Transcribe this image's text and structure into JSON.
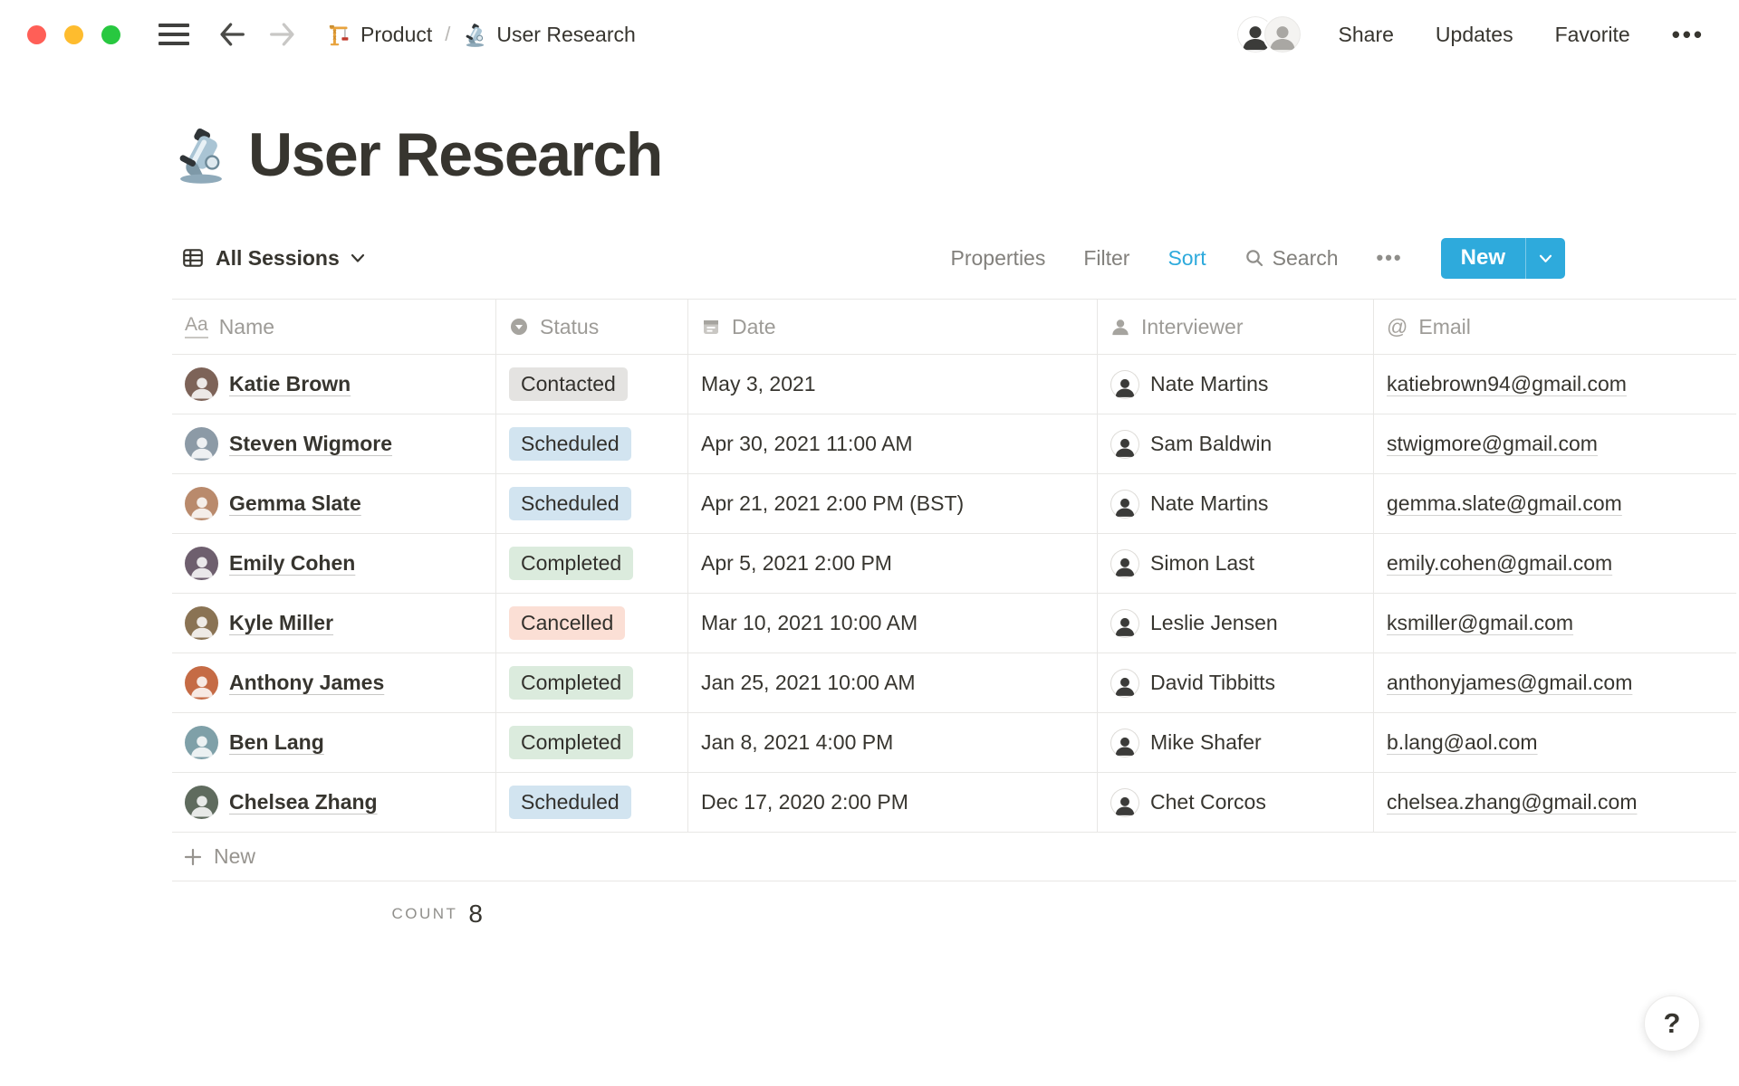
{
  "window": {
    "traffic_lights": {
      "close": "#FF5F57",
      "minimize": "#FEBC2E",
      "zoom": "#28C840"
    }
  },
  "topbar": {
    "breadcrumb": [
      {
        "icon": "crane-icon",
        "label": "Product"
      },
      {
        "icon": "microscope-icon",
        "label": "User Research"
      }
    ],
    "separator": "/",
    "share_label": "Share",
    "updates_label": "Updates",
    "favorite_label": "Favorite",
    "more_label": "•••"
  },
  "page": {
    "icon": "microscope-icon",
    "title": "User Research"
  },
  "view_toolbar": {
    "view_name": "All Sessions",
    "properties_label": "Properties",
    "filter_label": "Filter",
    "sort_label": "Sort",
    "sort_active_color": "#2EAADC",
    "search_label": "Search",
    "more_label": "•••",
    "new_button": {
      "label": "New",
      "color": "#2EAADC"
    }
  },
  "table": {
    "columns": [
      {
        "key": "name",
        "label": "Name",
        "icon": "text-icon"
      },
      {
        "key": "status",
        "label": "Status",
        "icon": "select-icon"
      },
      {
        "key": "date",
        "label": "Date",
        "icon": "calendar-icon"
      },
      {
        "key": "interviewer",
        "label": "Interviewer",
        "icon": "person-icon"
      },
      {
        "key": "email",
        "label": "Email",
        "icon": "at-icon"
      }
    ],
    "rows": [
      {
        "name": "Katie Brown",
        "status": "Contacted",
        "status_color": "gray",
        "date": "May 3, 2021",
        "interviewer": "Nate Martins",
        "email": "katiebrown94@gmail.com"
      },
      {
        "name": "Steven Wigmore",
        "status": "Scheduled",
        "status_color": "blue",
        "date": "Apr 30, 2021 11:00 AM",
        "interviewer": "Sam Baldwin",
        "email": "stwigmore@gmail.com"
      },
      {
        "name": "Gemma Slate",
        "status": "Scheduled",
        "status_color": "blue",
        "date": "Apr 21, 2021 2:00 PM (BST)",
        "interviewer": "Nate Martins",
        "email": "gemma.slate@gmail.com"
      },
      {
        "name": "Emily Cohen",
        "status": "Completed",
        "status_color": "green",
        "date": "Apr 5, 2021 2:00 PM",
        "interviewer": "Simon Last",
        "email": "emily.cohen@gmail.com"
      },
      {
        "name": "Kyle Miller",
        "status": "Cancelled",
        "status_color": "red",
        "date": "Mar 10, 2021 10:00 AM",
        "interviewer": "Leslie Jensen",
        "email": "ksmiller@gmail.com"
      },
      {
        "name": "Anthony James",
        "status": "Completed",
        "status_color": "green",
        "date": "Jan 25, 2021 10:00 AM",
        "interviewer": "David Tibbitts",
        "email": "anthonyjames@gmail.com"
      },
      {
        "name": "Ben Lang",
        "status": "Completed",
        "status_color": "green",
        "date": "Jan 8, 2021 4:00 PM",
        "interviewer": "Mike Shafer",
        "email": "b.lang@aol.com"
      },
      {
        "name": "Chelsea Zhang",
        "status": "Scheduled",
        "status_color": "blue",
        "date": "Dec 17, 2020 2:00 PM",
        "interviewer": "Chet Corcos",
        "email": "chelsea.zhang@gmail.com"
      }
    ],
    "new_row_label": "New",
    "footer": {
      "count_label": "COUNT",
      "count_value": "8"
    }
  },
  "status_colors": {
    "gray": {
      "bg": "#E4E3E1",
      "text": "#32302C"
    },
    "blue": {
      "bg": "#D2E4F0",
      "text": "#32302C"
    },
    "green": {
      "bg": "#DBEBDD",
      "text": "#32302C"
    },
    "red": {
      "bg": "#FBDFD5",
      "text": "#32302C"
    }
  },
  "help_button": {
    "label": "?"
  }
}
